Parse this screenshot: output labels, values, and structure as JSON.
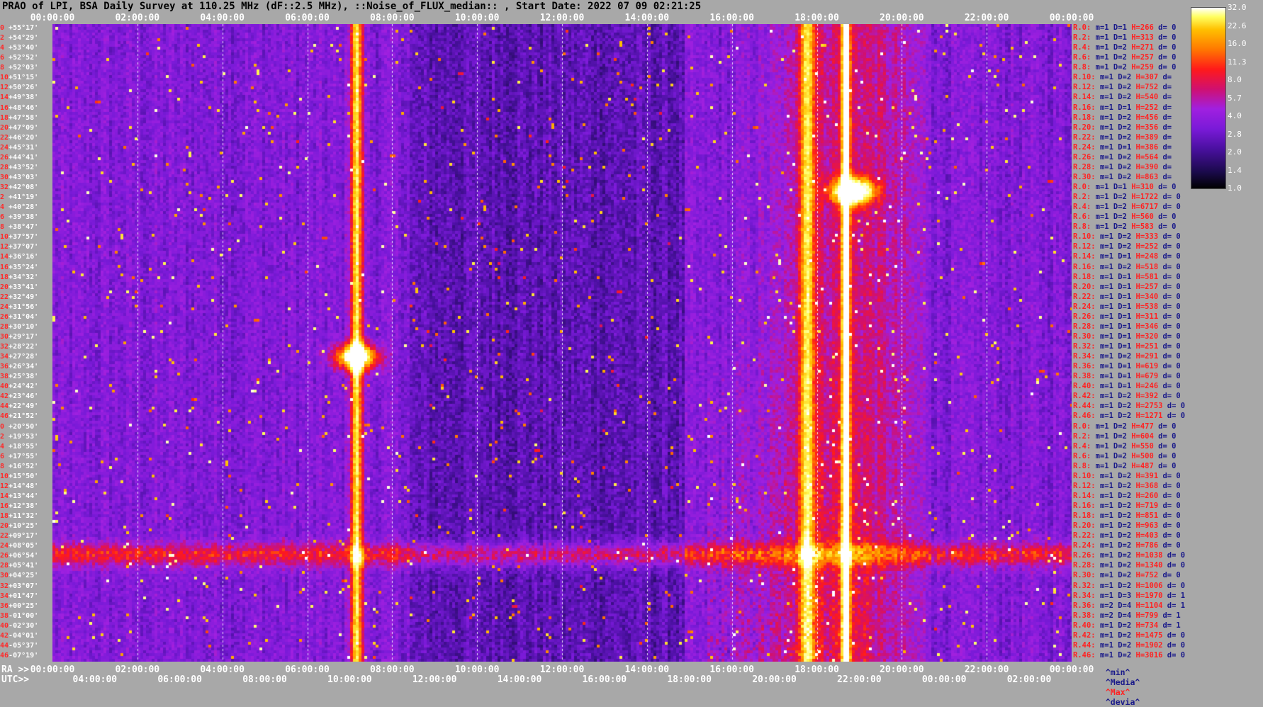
{
  "title": "PRAO of LPI, BSA Daily Survey at 110.25 MHz (dF::2.5 MHz), ::Noise_of_FLUX_median:: , Start Date: 2022 07 09 02:21:25",
  "top_axis_ticks": [
    "00:00:00",
    "02:00:00",
    "04:00:00",
    "06:00:00",
    "08:00:00",
    "10:00:00",
    "12:00:00",
    "14:00:00",
    "16:00:00",
    "18:00:00",
    "20:00:00",
    "22:00:00",
    "00:00:00"
  ],
  "ra_axis": {
    "prefix": "RA >>",
    "ticks": [
      "00:00:00",
      "02:00:00",
      "04:00:00",
      "06:00:00",
      "08:00:00",
      "10:00:00",
      "12:00:00",
      "14:00:00",
      "16:00:00",
      "18:00:00",
      "20:00:00",
      "22:00:00",
      "00:00:00"
    ]
  },
  "utc_axis": {
    "prefix": "UTC>>",
    "ticks": [
      "04:00:00",
      "06:00:00",
      "08:00:00",
      "10:00:00",
      "12:00:00",
      "14:00:00",
      "16:00:00",
      "18:00:00",
      "20:00:00",
      "22:00:00",
      "00:00:00",
      "02:00:00"
    ]
  },
  "dec_labels": [
    {
      "i": "0",
      "d": "+55°17'"
    },
    {
      "i": "2",
      "d": "+54°29'"
    },
    {
      "i": "4",
      "d": "+53°40'"
    },
    {
      "i": "6",
      "d": "+52°52'"
    },
    {
      "i": "8",
      "d": "+52°03'"
    },
    {
      "i": "10",
      "d": "+51°15'"
    },
    {
      "i": "12",
      "d": "+50°26'"
    },
    {
      "i": "14",
      "d": "+49°38'"
    },
    {
      "i": "16",
      "d": "+48°46'"
    },
    {
      "i": "18",
      "d": "+47°58'"
    },
    {
      "i": "20",
      "d": "+47°09'"
    },
    {
      "i": "22",
      "d": "+46°20'"
    },
    {
      "i": "24",
      "d": "+45°31'"
    },
    {
      "i": "26",
      "d": "+44°41'"
    },
    {
      "i": "28",
      "d": "+43°52'"
    },
    {
      "i": "30",
      "d": "+43°03'"
    },
    {
      "i": "32",
      "d": "+42°08'"
    },
    {
      "i": "2",
      "d": "+41°19'"
    },
    {
      "i": "4",
      "d": "+40°28'"
    },
    {
      "i": "6",
      "d": "+39°38'"
    },
    {
      "i": "8",
      "d": "+38°47'"
    },
    {
      "i": "10",
      "d": "+37°57'"
    },
    {
      "i": "12",
      "d": "+37°07'"
    },
    {
      "i": "14",
      "d": "+36°16'"
    },
    {
      "i": "16",
      "d": "+35°24'"
    },
    {
      "i": "18",
      "d": "+34°32'"
    },
    {
      "i": "20",
      "d": "+33°41'"
    },
    {
      "i": "22",
      "d": "+32°49'"
    },
    {
      "i": "24",
      "d": "+31°56'"
    },
    {
      "i": "26",
      "d": "+31°04'"
    },
    {
      "i": "28",
      "d": "+30°10'"
    },
    {
      "i": "30",
      "d": "+29°17'"
    },
    {
      "i": "32",
      "d": "+28°22'"
    },
    {
      "i": "34",
      "d": "+27°28'"
    },
    {
      "i": "36",
      "d": "+26°34'"
    },
    {
      "i": "38",
      "d": "+25°38'"
    },
    {
      "i": "40",
      "d": "+24°42'"
    },
    {
      "i": "42",
      "d": "+23°46'"
    },
    {
      "i": "44",
      "d": "+22°49'"
    },
    {
      "i": "46",
      "d": "+21°52'"
    },
    {
      "i": "0",
      "d": "+20°50'"
    },
    {
      "i": "2",
      "d": "+19°53'"
    },
    {
      "i": "4",
      "d": "+18°55'"
    },
    {
      "i": "6",
      "d": "+17°55'"
    },
    {
      "i": "8",
      "d": "+16°52'"
    },
    {
      "i": "10",
      "d": "+15°50'"
    },
    {
      "i": "12",
      "d": "+14°48'"
    },
    {
      "i": "14",
      "d": "+13°44'"
    },
    {
      "i": "16",
      "d": "+12°38'"
    },
    {
      "i": "18",
      "d": "+11°32'"
    },
    {
      "i": "20",
      "d": "+10°25'"
    },
    {
      "i": "22",
      "d": "+09°17'"
    },
    {
      "i": "24",
      "d": "+08°05'"
    },
    {
      "i": "26",
      "d": "+06°54'"
    },
    {
      "i": "28",
      "d": "+05°41'"
    },
    {
      "i": "30",
      "d": "+04°25'"
    },
    {
      "i": "32",
      "d": "+03°07'"
    },
    {
      "i": "34",
      "d": "+01°47'"
    },
    {
      "i": "36",
      "d": "+00°25'"
    },
    {
      "i": "38",
      "d": "-01°00'"
    },
    {
      "i": "40",
      "d": "-02°30'"
    },
    {
      "i": "42",
      "d": "-04°01'"
    },
    {
      "i": "44",
      "d": "-05°37'"
    },
    {
      "i": "46",
      "d": "-07°19'"
    }
  ],
  "stats_rows": [
    {
      "r": "R.0:",
      "m": "m=1",
      "d": "D=1",
      "h": "H=266",
      "dv": "d= 0"
    },
    {
      "r": "R.2:",
      "m": "m=1",
      "d": "D=1",
      "h": "H=313",
      "dv": "d= 0"
    },
    {
      "r": "R.4:",
      "m": "m=1",
      "d": "D=2",
      "h": "H=271",
      "dv": "d= 0"
    },
    {
      "r": "R.6:",
      "m": "m=1",
      "d": "D=2",
      "h": "H=257",
      "dv": "d= 0"
    },
    {
      "r": "R.8:",
      "m": "m=1",
      "d": "D=2",
      "h": "H=259",
      "dv": "d= 0"
    },
    {
      "r": "R.10:",
      "m": "m=1",
      "d": "D=2",
      "h": "H=307",
      "dv": "d="
    },
    {
      "r": "R.12:",
      "m": "m=1",
      "d": "D=2",
      "h": "H=752",
      "dv": "d="
    },
    {
      "r": "R.14:",
      "m": "m=1",
      "d": "D=2",
      "h": "H=540",
      "dv": "d="
    },
    {
      "r": "R.16:",
      "m": "m=1",
      "d": "D=1",
      "h": "H=252",
      "dv": "d="
    },
    {
      "r": "R.18:",
      "m": "m=1",
      "d": "D=2",
      "h": "H=456",
      "dv": "d="
    },
    {
      "r": "R.20:",
      "m": "m=1",
      "d": "D=2",
      "h": "H=356",
      "dv": "d="
    },
    {
      "r": "R.22:",
      "m": "m=1",
      "d": "D=2",
      "h": "H=389",
      "dv": "d="
    },
    {
      "r": "R.24:",
      "m": "m=1",
      "d": "D=1",
      "h": "H=386",
      "dv": "d="
    },
    {
      "r": "R.26:",
      "m": "m=1",
      "d": "D=2",
      "h": "H=564",
      "dv": "d="
    },
    {
      "r": "R.28:",
      "m": "m=1",
      "d": "D=2",
      "h": "H=390",
      "dv": "d="
    },
    {
      "r": "R.30:",
      "m": "m=1",
      "d": "D=2",
      "h": "H=863",
      "dv": "d="
    },
    {
      "r": "R.0:",
      "m": "m=1",
      "d": "D=1",
      "h": "H=310",
      "dv": "d= 0"
    },
    {
      "r": "R.2:",
      "m": "m=1",
      "d": "D=2",
      "h": "H=1722",
      "dv": "d= 0"
    },
    {
      "r": "R.4:",
      "m": "m=1",
      "d": "D=2",
      "h": "H=6717",
      "dv": "d= 0"
    },
    {
      "r": "R.6:",
      "m": "m=1",
      "d": "D=2",
      "h": "H=560",
      "dv": "d= 0"
    },
    {
      "r": "R.8:",
      "m": "m=1",
      "d": "D=2",
      "h": "H=583",
      "dv": "d= 0"
    },
    {
      "r": "R.10:",
      "m": "m=1",
      "d": "D=2",
      "h": "H=333",
      "dv": "d= 0"
    },
    {
      "r": "R.12:",
      "m": "m=1",
      "d": "D=2",
      "h": "H=252",
      "dv": "d= 0"
    },
    {
      "r": "R.14:",
      "m": "m=1",
      "d": "D=1",
      "h": "H=248",
      "dv": "d= 0"
    },
    {
      "r": "R.16:",
      "m": "m=1",
      "d": "D=2",
      "h": "H=518",
      "dv": "d= 0"
    },
    {
      "r": "R.18:",
      "m": "m=1",
      "d": "D=1",
      "h": "H=581",
      "dv": "d= 0"
    },
    {
      "r": "R.20:",
      "m": "m=1",
      "d": "D=1",
      "h": "H=257",
      "dv": "d= 0"
    },
    {
      "r": "R.22:",
      "m": "m=1",
      "d": "D=1",
      "h": "H=340",
      "dv": "d= 0"
    },
    {
      "r": "R.24:",
      "m": "m=1",
      "d": "D=1",
      "h": "H=538",
      "dv": "d= 0"
    },
    {
      "r": "R.26:",
      "m": "m=1",
      "d": "D=1",
      "h": "H=311",
      "dv": "d= 0"
    },
    {
      "r": "R.28:",
      "m": "m=1",
      "d": "D=1",
      "h": "H=346",
      "dv": "d= 0"
    },
    {
      "r": "R.30:",
      "m": "m=1",
      "d": "D=1",
      "h": "H=320",
      "dv": "d= 0"
    },
    {
      "r": "R.32:",
      "m": "m=1",
      "d": "D=1",
      "h": "H=251",
      "dv": "d= 0"
    },
    {
      "r": "R.34:",
      "m": "m=1",
      "d": "D=2",
      "h": "H=291",
      "dv": "d= 0"
    },
    {
      "r": "R.36:",
      "m": "m=1",
      "d": "D=1",
      "h": "H=619",
      "dv": "d= 0"
    },
    {
      "r": "R.38:",
      "m": "m=1",
      "d": "D=1",
      "h": "H=679",
      "dv": "d= 0"
    },
    {
      "r": "R.40:",
      "m": "m=1",
      "d": "D=1",
      "h": "H=246",
      "dv": "d= 0"
    },
    {
      "r": "R.42:",
      "m": "m=1",
      "d": "D=2",
      "h": "H=392",
      "dv": "d= 0"
    },
    {
      "r": "R.44:",
      "m": "m=1",
      "d": "D=2",
      "h": "H=2753",
      "dv": "d= 0"
    },
    {
      "r": "R.46:",
      "m": "m=1",
      "d": "D=2",
      "h": "H=1271",
      "dv": "d= 0"
    },
    {
      "r": "R.0:",
      "m": "m=1",
      "d": "D=2",
      "h": "H=477",
      "dv": "d= 0"
    },
    {
      "r": "R.2:",
      "m": "m=1",
      "d": "D=2",
      "h": "H=604",
      "dv": "d= 0"
    },
    {
      "r": "R.4:",
      "m": "m=1",
      "d": "D=2",
      "h": "H=550",
      "dv": "d= 0"
    },
    {
      "r": "R.6:",
      "m": "m=1",
      "d": "D=2",
      "h": "H=500",
      "dv": "d= 0"
    },
    {
      "r": "R.8:",
      "m": "m=1",
      "d": "D=2",
      "h": "H=487",
      "dv": "d= 0"
    },
    {
      "r": "R.10:",
      "m": "m=1",
      "d": "D=2",
      "h": "H=391",
      "dv": "d= 0"
    },
    {
      "r": "R.12:",
      "m": "m=1",
      "d": "D=2",
      "h": "H=368",
      "dv": "d= 0"
    },
    {
      "r": "R.14:",
      "m": "m=1",
      "d": "D=2",
      "h": "H=260",
      "dv": "d= 0"
    },
    {
      "r": "R.16:",
      "m": "m=1",
      "d": "D=2",
      "h": "H=719",
      "dv": "d= 0"
    },
    {
      "r": "R.18:",
      "m": "m=1",
      "d": "D=2",
      "h": "H=851",
      "dv": "d= 0"
    },
    {
      "r": "R.20:",
      "m": "m=1",
      "d": "D=2",
      "h": "H=963",
      "dv": "d= 0"
    },
    {
      "r": "R.22:",
      "m": "m=1",
      "d": "D=2",
      "h": "H=403",
      "dv": "d= 0"
    },
    {
      "r": "R.24:",
      "m": "m=1",
      "d": "D=2",
      "h": "H=786",
      "dv": "d= 0"
    },
    {
      "r": "R.26:",
      "m": "m=1",
      "d": "D=2",
      "h": "H=1038",
      "dv": "d= 0"
    },
    {
      "r": "R.28:",
      "m": "m=1",
      "d": "D=2",
      "h": "H=1340",
      "dv": "d= 0"
    },
    {
      "r": "R.30:",
      "m": "m=1",
      "d": "D=2",
      "h": "H=752",
      "dv": "d= 0"
    },
    {
      "r": "R.32:",
      "m": "m=1",
      "d": "D=2",
      "h": "H=1006",
      "dv": "d= 0"
    },
    {
      "r": "R.34:",
      "m": "m=1",
      "d": "D=3",
      "h": "H=1970",
      "dv": "d= 1"
    },
    {
      "r": "R.36:",
      "m": "m=2",
      "d": "D=4",
      "h": "H=1104",
      "dv": "d= 1"
    },
    {
      "r": "R.38:",
      "m": "m=2",
      "d": "D=4",
      "h": "H=799",
      "dv": "d= 1"
    },
    {
      "r": "R.40:",
      "m": "m=1",
      "d": "D=2",
      "h": "H=734",
      "dv": "d= 1"
    },
    {
      "r": "R.42:",
      "m": "m=1",
      "d": "D=2",
      "h": "H=1475",
      "dv": "d= 0"
    },
    {
      "r": "R.44:",
      "m": "m=1",
      "d": "D=2",
      "h": "H=1902",
      "dv": "d= 0"
    },
    {
      "r": "R.46:",
      "m": "m=1",
      "d": "D=2",
      "h": "H=3016",
      "dv": "d= 0"
    }
  ],
  "bottom_legend": {
    "min": "^min^",
    "median": "^Media^",
    "max": "^Max^",
    "devia": "^devia^"
  },
  "colorbar": {
    "ticks": [
      "32.0",
      "22.6",
      "16.0",
      "11.3",
      "8.0",
      "5.7",
      "4.0",
      "2.8",
      "2.0",
      "1.4",
      "1.0"
    ],
    "colors": [
      "#000000",
      "#1a0a4a",
      "#4a10a0",
      "#7a1ad8",
      "#a020e0",
      "#d01070",
      "#ff1a1a",
      "#ff7800",
      "#ffc000",
      "#ffff60",
      "#ffffff"
    ]
  },
  "chart_data": {
    "type": "heatmap",
    "title": "PRAO of LPI, BSA Daily Survey at 110.25 MHz (dF::2.5 MHz), ::Noise_of_FLUX_median:: , Start Date: 2022 07 09 02:21:25",
    "xlabel": "RA",
    "x_range": [
      "00:00:00",
      "00:00:00"
    ],
    "y_range": [
      "+55°17'",
      "-07°19'"
    ],
    "color_scale": "log",
    "color_range": [
      1.0,
      32.0
    ],
    "features": [
      {
        "kind": "source",
        "ra": "07:30",
        "dec": "+22°49'",
        "level": 32.0
      },
      {
        "kind": "source",
        "ra": "19:55",
        "dec": "+40°28'",
        "level": 32.0
      },
      {
        "kind": "vertical-band",
        "ra": "07:30",
        "level": 11.3
      },
      {
        "kind": "vertical-band",
        "ra": "18:50",
        "level": 16.0
      },
      {
        "kind": "vertical-band",
        "ra": "19:55",
        "level": 8.0
      },
      {
        "kind": "horizontal-band",
        "dec": "+00°25'",
        "level": 8.0
      }
    ]
  }
}
